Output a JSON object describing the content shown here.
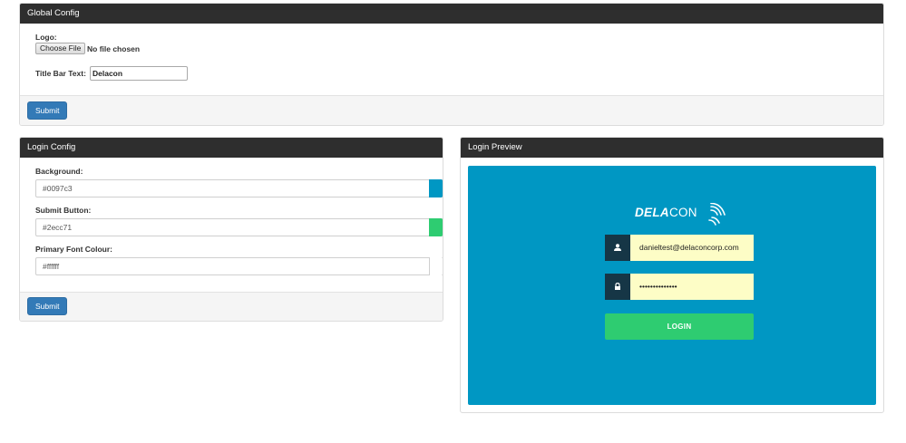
{
  "global_config": {
    "title": "Global Config",
    "logo_label": "Logo:",
    "file_button_label": "Choose File",
    "file_status": "No file chosen",
    "title_bar_label": "Title Bar Text:",
    "title_bar_value": "Delacon",
    "submit_label": "Submit"
  },
  "login_config": {
    "title": "Login Config",
    "fields": [
      {
        "label": "Background:",
        "value": "#0097c3",
        "swatch": "#0097c3"
      },
      {
        "label": "Submit Button:",
        "value": "#2ecc71",
        "swatch": "#2ecc71"
      },
      {
        "label": "Primary Font Colour:",
        "value": "#ffffff",
        "swatch": "#ffffff"
      }
    ],
    "submit_label": "Submit"
  },
  "login_preview": {
    "title": "Login Preview",
    "background_color": "#0097c3",
    "button_color": "#2ecc71",
    "font_color": "#ffffff",
    "logo_bold": "DELA",
    "logo_light": "CON",
    "email_icon": "user-icon",
    "email_value": "danieltest@delaconcorp.com",
    "password_icon": "lock-icon",
    "password_mask": "••••••••••••••",
    "login_label": "LOGIN"
  }
}
